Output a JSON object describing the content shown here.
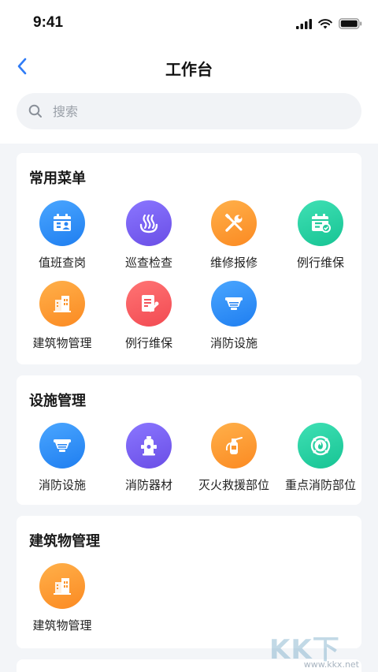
{
  "status_bar": {
    "time": "9:41"
  },
  "nav": {
    "title": "工作台"
  },
  "search": {
    "placeholder": "搜索",
    "value": ""
  },
  "sections": [
    {
      "title": "常用菜单",
      "items": [
        {
          "label": "值班查岗",
          "icon": "duty-check-icon",
          "color": "blue"
        },
        {
          "label": "巡查检查",
          "icon": "patrol-icon",
          "color": "purple"
        },
        {
          "label": "维修报修",
          "icon": "repair-tools-icon",
          "color": "orange"
        },
        {
          "label": "例行维保",
          "icon": "maintenance-calendar-icon",
          "color": "teal"
        },
        {
          "label": "建筑物管理",
          "icon": "building-icon",
          "color": "orange"
        },
        {
          "label": "例行维保",
          "icon": "maintenance-doc-icon",
          "color": "red"
        },
        {
          "label": "消防设施",
          "icon": "smoke-detector-icon",
          "color": "blue"
        }
      ]
    },
    {
      "title": "设施管理",
      "items": [
        {
          "label": "消防设施",
          "icon": "smoke-detector-icon",
          "color": "blue"
        },
        {
          "label": "消防器材",
          "icon": "fire-hydrant-icon",
          "color": "purple"
        },
        {
          "label": "灭火救援部位",
          "icon": "fire-extinguisher-icon",
          "color": "orange"
        },
        {
          "label": "重点消防部位",
          "icon": "fire-target-icon",
          "color": "teal"
        }
      ]
    },
    {
      "title": "建筑物管理",
      "items": [
        {
          "label": "建筑物管理",
          "icon": "building-icon",
          "color": "orange"
        }
      ]
    }
  ],
  "watermark": {
    "text": "KK下载",
    "url": "www.kkx.net"
  }
}
